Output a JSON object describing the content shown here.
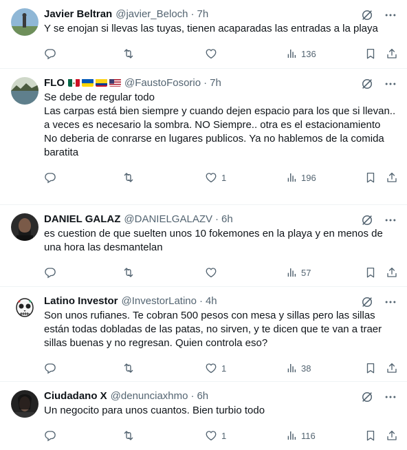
{
  "tweets": [
    {
      "name": "Javier Beltran",
      "handle": "@javier_Beloch",
      "time": "7h",
      "text": "Y se enojan si llevas las tuyas, tienen acaparadas las entradas a la playa",
      "replies": "",
      "retweets": "",
      "likes": "",
      "views": "136",
      "avatar": "landscape-avatar",
      "flags": []
    },
    {
      "name": "FLO",
      "handle": "@FaustoFosorio",
      "time": "7h",
      "text": "Se debe de regular todo\nLas carpas está bien siempre y cuando dejen espacio para los que si llevan.. a veces es necesario la sombra. NO Siempre.. otra es el estacionamiento\nNo deberia de conrarse en lugares publicos. Ya no hablemos de la comida baratita",
      "replies": "",
      "retweets": "",
      "likes": "1",
      "views": "196",
      "avatar": "lake-avatar",
      "flags": [
        "mexico-flag",
        "ukraine-flag",
        "colombia-flag",
        "usa-flag"
      ]
    },
    {
      "name": "DANIEL GALAZ",
      "handle": "@DANIELGALAZV",
      "time": "6h",
      "text": "es cuestion de que suelten unos 10 fokemones en la playa y en menos de una hora las desmantelan",
      "replies": "",
      "retweets": "",
      "likes": "",
      "views": "57",
      "avatar": "person-avatar",
      "flags": []
    },
    {
      "name": "Latino Investor",
      "handle": "@InvestorLatino",
      "time": "4h",
      "text": "Son unos rufianes. Te cobran 500 pesos con mesa y sillas pero las sillas están todas dobladas de las patas, no sirven, y te dicen que te van a traer sillas buenas y no regresan. Quien controla eso?",
      "replies": "",
      "retweets": "",
      "likes": "1",
      "views": "38",
      "avatar": "skull-avatar",
      "flags": []
    },
    {
      "name": "Ciudadano X",
      "handle": "@denunciaxhmo",
      "time": "6h",
      "text": "Un negocito para unos cuantos. Bien turbio todo",
      "replies": "",
      "retweets": "",
      "likes": "1",
      "views": "116",
      "avatar": "dark-person-avatar",
      "flags": []
    }
  ],
  "separator": "·",
  "colors": {
    "text": "#0f1419",
    "muted": "#536471",
    "border": "#eff3f4"
  },
  "icons": [
    "grok-icon",
    "more-icon",
    "reply-icon",
    "retweet-icon",
    "like-icon",
    "views-icon",
    "bookmark-icon",
    "share-icon"
  ]
}
